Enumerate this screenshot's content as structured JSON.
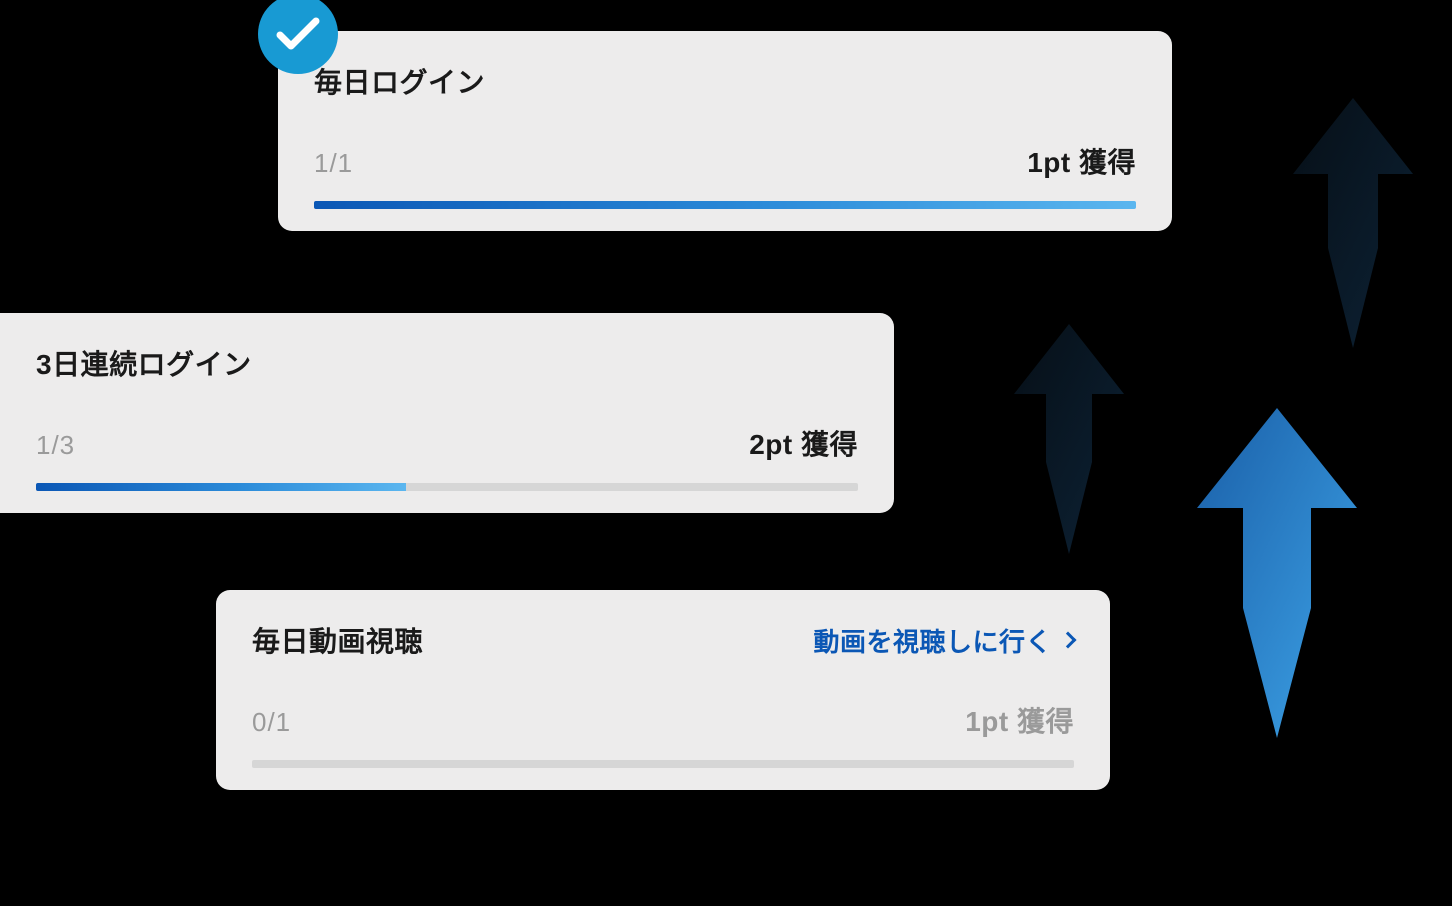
{
  "cards": [
    {
      "title": "毎日ログイン",
      "progress": "1/1",
      "reward": "1pt 獲得",
      "progress_percent": 100,
      "completed": true,
      "action_link": null
    },
    {
      "title": "3日連続ログイン",
      "progress": "1/3",
      "reward": "2pt 獲得",
      "progress_percent": 33,
      "completed": false,
      "action_link": null
    },
    {
      "title": "毎日動画視聴",
      "progress": "0/1",
      "reward": "1pt 獲得",
      "progress_percent": 0,
      "completed": false,
      "action_link": "動画を視聴しに行く"
    }
  ],
  "colors": {
    "accent_blue": "#0b57b5",
    "light_blue": "#5bb6ef",
    "badge_blue": "#189ad3",
    "muted_text": "#9a9a9a",
    "card_bg": "#edecec",
    "dark_arrow": "#0a1824",
    "bright_arrow_start": "#1a5fa8",
    "bright_arrow_end": "#3ea4e8"
  }
}
